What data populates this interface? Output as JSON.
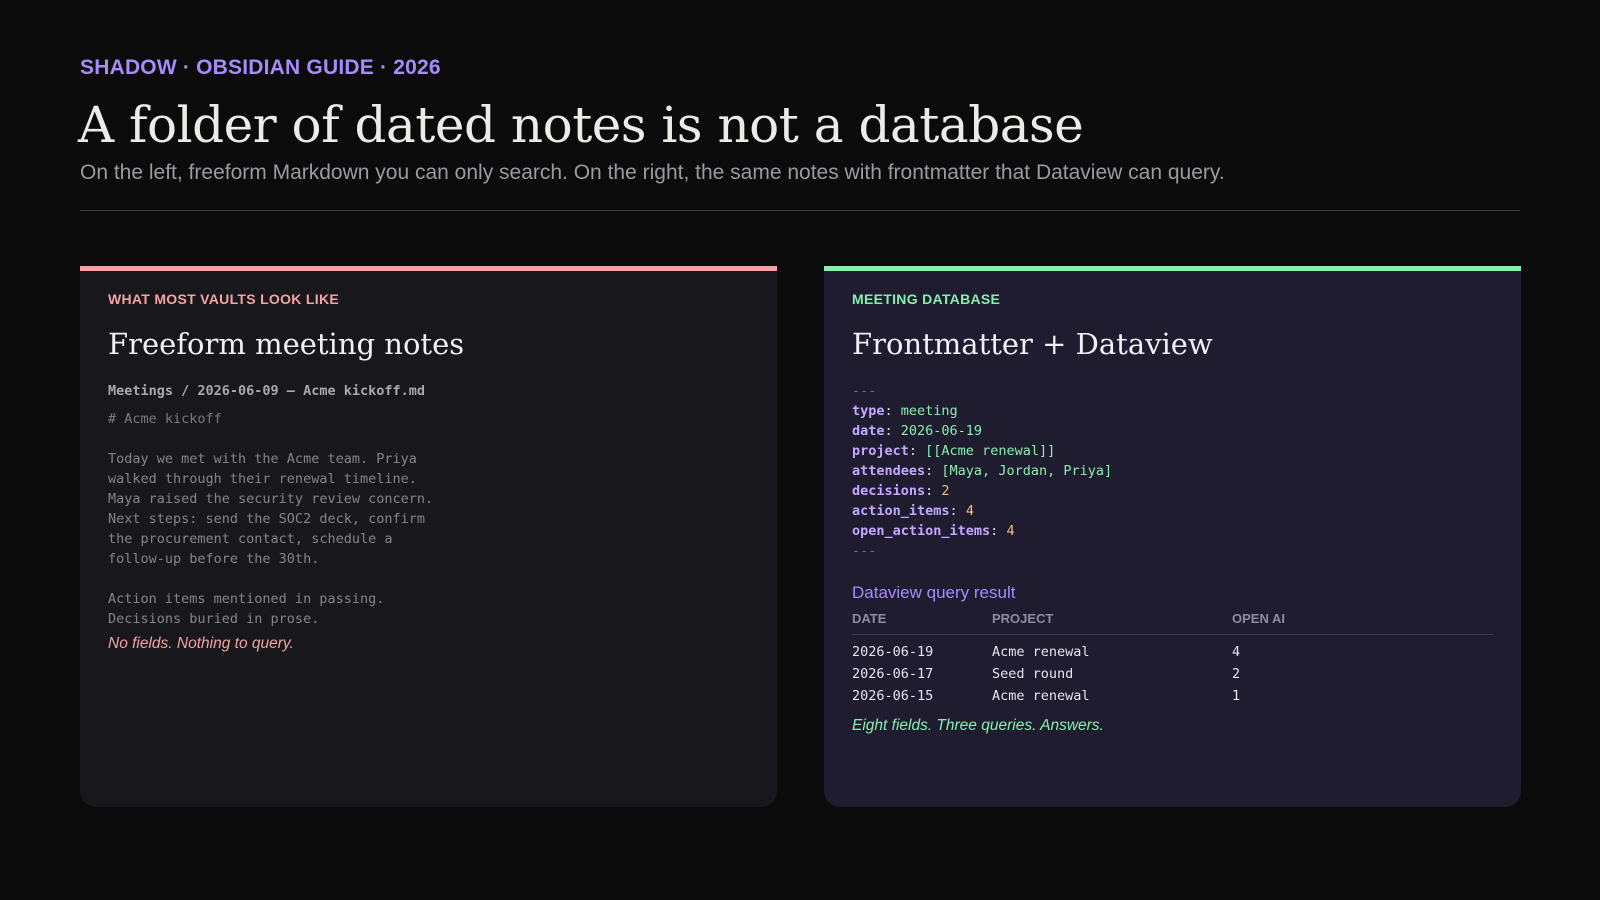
{
  "header": {
    "kicker": "SHADOW · OBSIDIAN GUIDE · 2026",
    "title": "A folder of dated notes is not a database",
    "subtitle": "On the left, freeform Markdown you can only search. On the right, the same notes with frontmatter that Dataview can query."
  },
  "colors": {
    "accent": "#a78bfa",
    "bad": "#f4a3a3",
    "good": "#86efac",
    "number": "#fdba74"
  },
  "left": {
    "label": "WHAT MOST VAULTS LOOK LIKE",
    "title": "Freeform meeting notes",
    "file_path": "Meetings / 2026-06-09 — Acme kickoff.md",
    "heading": "# Acme kickoff",
    "paragraph1": "Today we met with the Acme team. Priya\nwalked through their renewal timeline.\nMaya raised the security review concern.\nNext steps: send the SOC2 deck, confirm\nthe procurement contact, schedule a\nfollow-up before the 30th.",
    "paragraph2": "Action items mentioned in passing.\nDecisions buried in prose.",
    "verdict": "No fields. Nothing to query."
  },
  "right": {
    "label": "MEETING DATABASE",
    "title": "Frontmatter + Dataview",
    "delimiter": "---",
    "frontmatter": [
      {
        "key": "type",
        "value": "meeting",
        "kind": "str"
      },
      {
        "key": "date",
        "value": "2026-06-19",
        "kind": "str"
      },
      {
        "key": "project",
        "value": "[[Acme renewal]]",
        "kind": "str"
      },
      {
        "key": "attendees",
        "value": "[Maya, Jordan, Priya]",
        "kind": "str"
      },
      {
        "key": "decisions",
        "value": "2",
        "kind": "num"
      },
      {
        "key": "action_items",
        "value": "4",
        "kind": "num"
      },
      {
        "key": "open_action_items",
        "value": "4",
        "kind": "num"
      }
    ],
    "query_title": "Dataview query result",
    "columns": [
      "DATE",
      "PROJECT",
      "OPEN AI"
    ],
    "rows": [
      [
        "2026-06-19",
        "Acme renewal",
        "4"
      ],
      [
        "2026-06-17",
        "Seed round",
        "2"
      ],
      [
        "2026-06-15",
        "Acme renewal",
        "1"
      ]
    ],
    "verdict": "Eight fields. Three queries. Answers."
  }
}
